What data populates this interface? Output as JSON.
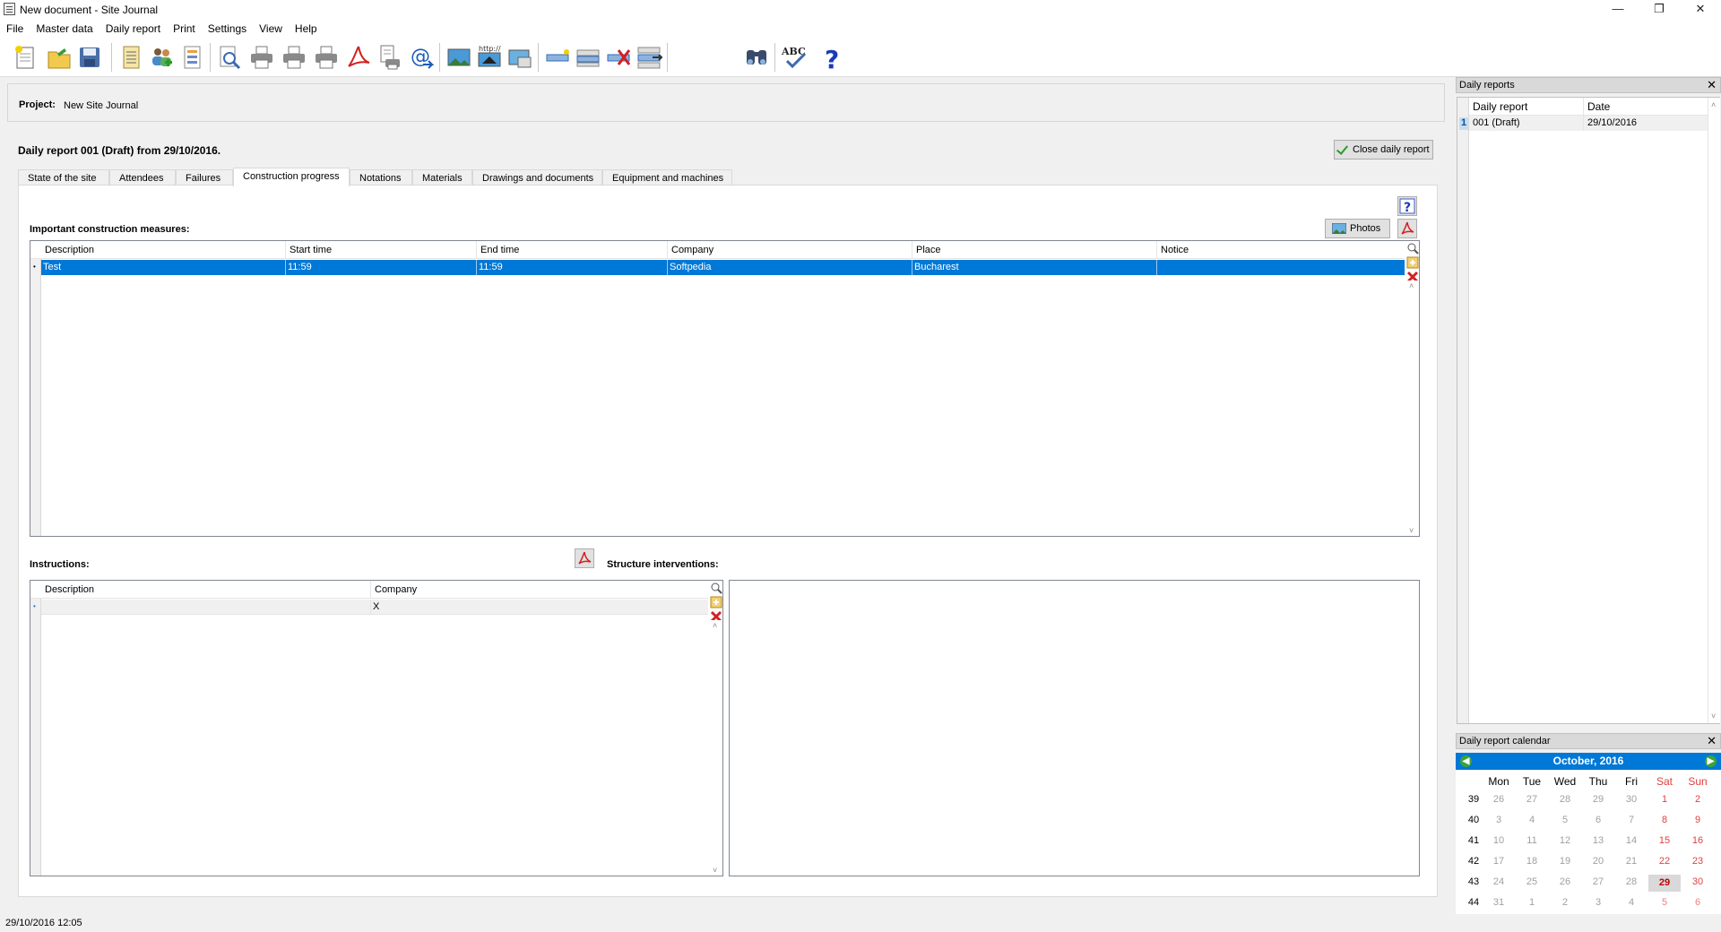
{
  "window": {
    "title": "New document - Site Journal",
    "minimize": "—",
    "maximize": "❐",
    "close": "✕"
  },
  "menu": [
    "File",
    "Master data",
    "Daily report",
    "Print",
    "Settings",
    "View",
    "Help"
  ],
  "toolbar": {
    "icons": [
      "new-document-icon",
      "open-icon",
      "save-icon",
      "report-icon",
      "attendees-icon",
      "list-icon",
      "preview-icon",
      "print-icon",
      "print2-icon",
      "print3-icon",
      "pdf-icon",
      "print-setup-icon",
      "email-icon",
      "image-icon",
      "web-image-icon",
      "picture-icon",
      "add-row-icon",
      "edit-row-icon",
      "delete-row-icon",
      "move-row-icon",
      "search-icon",
      "spellcheck-icon",
      "help-icon"
    ],
    "spell_label": "ABC",
    "help_label": "?"
  },
  "project": {
    "label": "Project:",
    "value": "New Site Journal"
  },
  "report": {
    "title": "Daily report 001 (Draft) from 29/10/2016.",
    "close_label": "Close daily report"
  },
  "tabs": [
    "State of the site",
    "Attendees",
    "Failures",
    "Construction progress",
    "Notations",
    "Materials",
    "Drawings and documents",
    "Equipment and machines"
  ],
  "construction": {
    "label": "Important construction measures:",
    "photos_label": "Photos",
    "columns": [
      "Description",
      "Start time",
      "End time",
      "Company",
      "Place",
      "Notice"
    ],
    "rows": [
      [
        "Test",
        "11:59",
        "11:59",
        "Softpedia",
        "Bucharest",
        ""
      ]
    ]
  },
  "instructions": {
    "label": "Instructions:",
    "columns": [
      "Description",
      "Company"
    ],
    "rows": [
      [
        "",
        "X"
      ]
    ]
  },
  "structure": {
    "label": "Structure interventions:"
  },
  "daily_reports": {
    "title": "Daily reports",
    "columns": [
      "Daily report",
      "Date"
    ],
    "rows": [
      {
        "n": "1",
        "report": "001 (Draft)",
        "date": "29/10/2016"
      }
    ]
  },
  "calendar": {
    "title": "Daily report calendar",
    "month": "October, 2016",
    "days": [
      "Mon",
      "Tue",
      "Wed",
      "Thu",
      "Fri",
      "Sat",
      "Sun"
    ],
    "weeks": [
      {
        "wk": "39",
        "d": [
          "26",
          "27",
          "28",
          "29",
          "30",
          "1",
          "2"
        ]
      },
      {
        "wk": "40",
        "d": [
          "3",
          "4",
          "5",
          "6",
          "7",
          "8",
          "9"
        ]
      },
      {
        "wk": "41",
        "d": [
          "10",
          "11",
          "12",
          "13",
          "14",
          "15",
          "16"
        ]
      },
      {
        "wk": "42",
        "d": [
          "17",
          "18",
          "19",
          "20",
          "21",
          "22",
          "23"
        ]
      },
      {
        "wk": "43",
        "d": [
          "24",
          "25",
          "26",
          "27",
          "28",
          "29",
          "30"
        ]
      },
      {
        "wk": "44",
        "d": [
          "31",
          "1",
          "2",
          "3",
          "4",
          "5",
          "6"
        ]
      }
    ],
    "selected": "29"
  },
  "status": "29/10/2016 12:05",
  "colors": {
    "accent": "#0078d7",
    "weekend": "#e04040",
    "pdf": "#d42020"
  }
}
